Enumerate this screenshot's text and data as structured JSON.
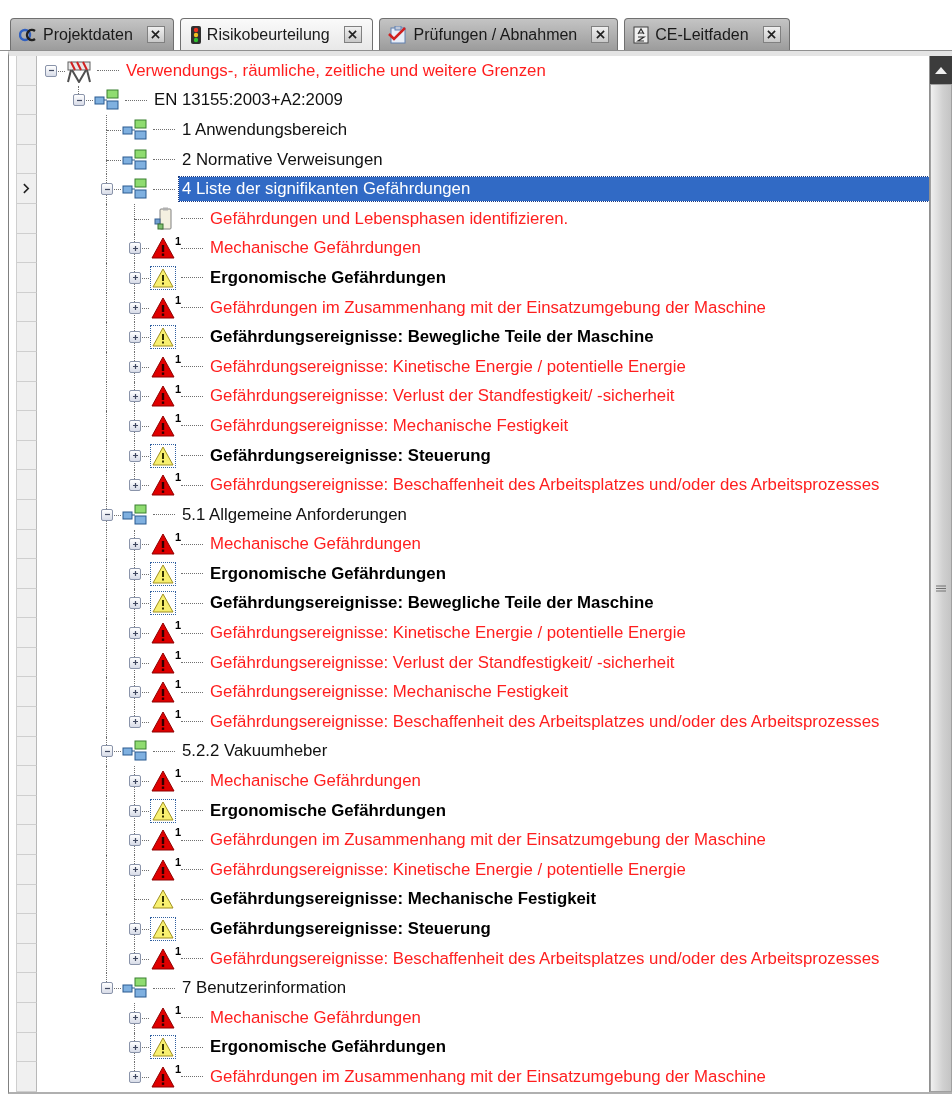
{
  "tabs": [
    {
      "label": "Projektdaten",
      "selected": false
    },
    {
      "label": "Risikobeurteilung",
      "selected": true
    },
    {
      "label": "Prüfungen / Abnahmen",
      "selected": false
    },
    {
      "label": "CE-Leitfaden",
      "selected": false
    }
  ],
  "tree": {
    "kind": "root",
    "text": "Verwendungs-, räumliche, zeitliche und weitere Grenzen",
    "expanded": true,
    "selected": false,
    "children": [
      {
        "kind": "norm",
        "text": "EN 13155:2003+A2:2009",
        "expanded": true,
        "selected": false,
        "children": [
          {
            "kind": "norm",
            "text": "1 Anwendungsbereich",
            "selected": false
          },
          {
            "kind": "norm",
            "text": "2 Normative Verweisungen",
            "selected": false
          },
          {
            "kind": "norm",
            "text": "4 Liste der signifikanten Gefährdungen",
            "expanded": true,
            "selected": true,
            "children": [
              {
                "kind": "task",
                "text": "Gefährdungen und Lebensphasen identifizieren.",
                "selected": false
              },
              {
                "kind": "hazard",
                "badge": "1",
                "text": "Mechanische Gefährdungen",
                "expanded": false,
                "selected": false
              },
              {
                "kind": "warning",
                "text": "Ergonomische Gefährdungen",
                "expanded": false,
                "selected": false
              },
              {
                "kind": "hazard",
                "badge": "1",
                "text": "Gefährdungen im Zusammenhang mit der Einsatzumgebung der Maschine",
                "expanded": false,
                "selected": false
              },
              {
                "kind": "warning",
                "text": "Gefährdungsereignisse: Bewegliche Teile der Maschine",
                "expanded": false,
                "selected": false
              },
              {
                "kind": "hazard",
                "badge": "1",
                "text": "Gefährdungsereignisse: Kinetische Energie / potentielle Energie",
                "expanded": false,
                "selected": false
              },
              {
                "kind": "hazard",
                "badge": "1",
                "text": "Gefährdungsereignisse: Verlust der Standfestigkeit/ -sicherheit",
                "expanded": false,
                "selected": false
              },
              {
                "kind": "hazard",
                "badge": "1",
                "text": "Gefährdungsereignisse: Mechanische Festigkeit",
                "expanded": false,
                "selected": false
              },
              {
                "kind": "warning",
                "text": "Gefährdungsereignisse: Steuerung",
                "expanded": false,
                "selected": false
              },
              {
                "kind": "hazard",
                "badge": "1",
                "text": "Gefährdungsereignisse: Beschaffenheit des Arbeitsplatzes und/oder des Arbeitsprozesses",
                "expanded": false,
                "selected": false
              }
            ]
          },
          {
            "kind": "norm",
            "text": "5.1 Allgemeine Anforderungen",
            "expanded": true,
            "selected": false,
            "children": [
              {
                "kind": "hazard",
                "badge": "1",
                "text": "Mechanische Gefährdungen",
                "expanded": false,
                "selected": false
              },
              {
                "kind": "warning",
                "text": "Ergonomische Gefährdungen",
                "expanded": false,
                "selected": false
              },
              {
                "kind": "warning",
                "text": "Gefährdungsereignisse: Bewegliche Teile der Maschine",
                "expanded": false,
                "selected": false
              },
              {
                "kind": "hazard",
                "badge": "1",
                "text": "Gefährdungsereignisse: Kinetische Energie / potentielle Energie",
                "expanded": false,
                "selected": false
              },
              {
                "kind": "hazard",
                "badge": "1",
                "text": "Gefährdungsereignisse: Verlust der Standfestigkeit/ -sicherheit",
                "expanded": false,
                "selected": false
              },
              {
                "kind": "hazard",
                "badge": "1",
                "text": "Gefährdungsereignisse: Mechanische Festigkeit",
                "expanded": false,
                "selected": false
              },
              {
                "kind": "hazard",
                "badge": "1",
                "text": "Gefährdungsereignisse: Beschaffenheit des Arbeitsplatzes und/oder des Arbeitsprozesses",
                "expanded": false,
                "selected": false
              }
            ]
          },
          {
            "kind": "norm",
            "text": "5.2.2 Vakuumheber",
            "expanded": true,
            "selected": false,
            "children": [
              {
                "kind": "hazard",
                "badge": "1",
                "text": "Mechanische Gefährdungen",
                "expanded": false,
                "selected": false
              },
              {
                "kind": "warning",
                "text": "Ergonomische Gefährdungen",
                "expanded": false,
                "selected": false
              },
              {
                "kind": "hazard",
                "badge": "1",
                "text": "Gefährdungen im Zusammenhang mit der Einsatzumgebung der Maschine",
                "expanded": false,
                "selected": false
              },
              {
                "kind": "hazard",
                "badge": "1",
                "text": "Gefährdungsereignisse: Kinetische Energie / potentielle Energie",
                "expanded": false,
                "selected": false
              },
              {
                "kind": "warning",
                "text": "Gefährdungsereignisse: Mechanische Festigkeit",
                "selected": false
              },
              {
                "kind": "warning",
                "text": "Gefährdungsereignisse: Steuerung",
                "expanded": false,
                "selected": false
              },
              {
                "kind": "hazard",
                "badge": "1",
                "text": "Gefährdungsereignisse: Beschaffenheit des Arbeitsplatzes und/oder des Arbeitsprozesses",
                "expanded": false,
                "selected": false
              }
            ]
          },
          {
            "kind": "norm",
            "text": "7 Benutzerinformation",
            "expanded": true,
            "selected": false,
            "children": [
              {
                "kind": "hazard",
                "badge": "1",
                "text": "Mechanische Gefährdungen",
                "expanded": false,
                "selected": false
              },
              {
                "kind": "warning",
                "text": "Ergonomische Gefährdungen",
                "expanded": false,
                "selected": false
              },
              {
                "kind": "hazard",
                "badge": "1",
                "text": "Gefährdungen im Zusammenhang mit der Einsatzumgebung der Maschine",
                "expanded": false,
                "selected": false
              }
            ]
          }
        ]
      }
    ]
  }
}
